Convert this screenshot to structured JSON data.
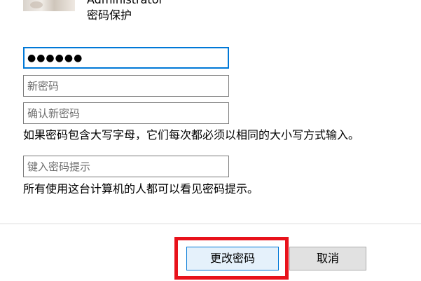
{
  "user": {
    "name": "Administrator",
    "subtitle": "密码保护"
  },
  "form": {
    "current_password_value": "●●●●●●",
    "new_password_placeholder": "新密码",
    "confirm_password_placeholder": "确认新密码",
    "case_note": "如果密码包含大写字母，它们每次都必须以相同的大小写方式输入。",
    "hint_placeholder": "键入密码提示",
    "hint_note": "所有使用这台计算机的人都可以看见密码提示。"
  },
  "buttons": {
    "change_password_label": "更改密码",
    "cancel_label": "取消"
  },
  "colors": {
    "highlight": "#e8121b",
    "focus_border": "#0078d7"
  }
}
